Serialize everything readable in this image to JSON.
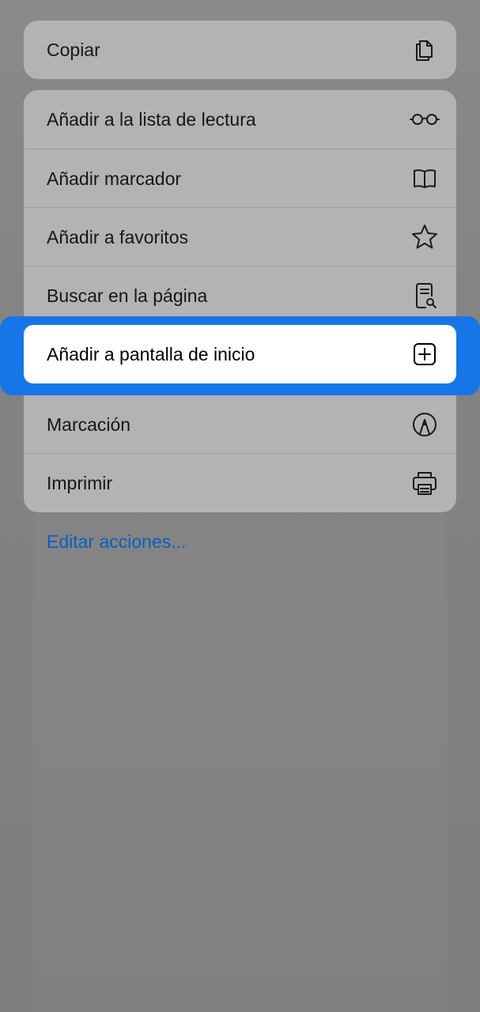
{
  "menu": {
    "top_group": [
      {
        "label": "Copiar",
        "icon": "copy-icon"
      }
    ],
    "main_group": [
      {
        "label": "Añadir a la lista de lectura",
        "icon": "reading-glasses-icon"
      },
      {
        "label": "Añadir marcador",
        "icon": "book-icon"
      },
      {
        "label": "Añadir a favoritos",
        "icon": "star-icon"
      },
      {
        "label": "Buscar en la página",
        "icon": "find-in-page-icon"
      },
      {
        "label": "Añadir a pantalla de inicio",
        "icon": "plus-square-icon",
        "highlighted": true
      },
      {
        "label": "Marcación",
        "icon": "markup-pen-icon"
      },
      {
        "label": "Imprimir",
        "icon": "printer-icon"
      }
    ],
    "edit_actions": "Editar acciones..."
  },
  "colors": {
    "highlight": "#1676e8",
    "link": "#0a5fc0",
    "dim_background": "#838383",
    "group_background": "#b3b3b3"
  }
}
